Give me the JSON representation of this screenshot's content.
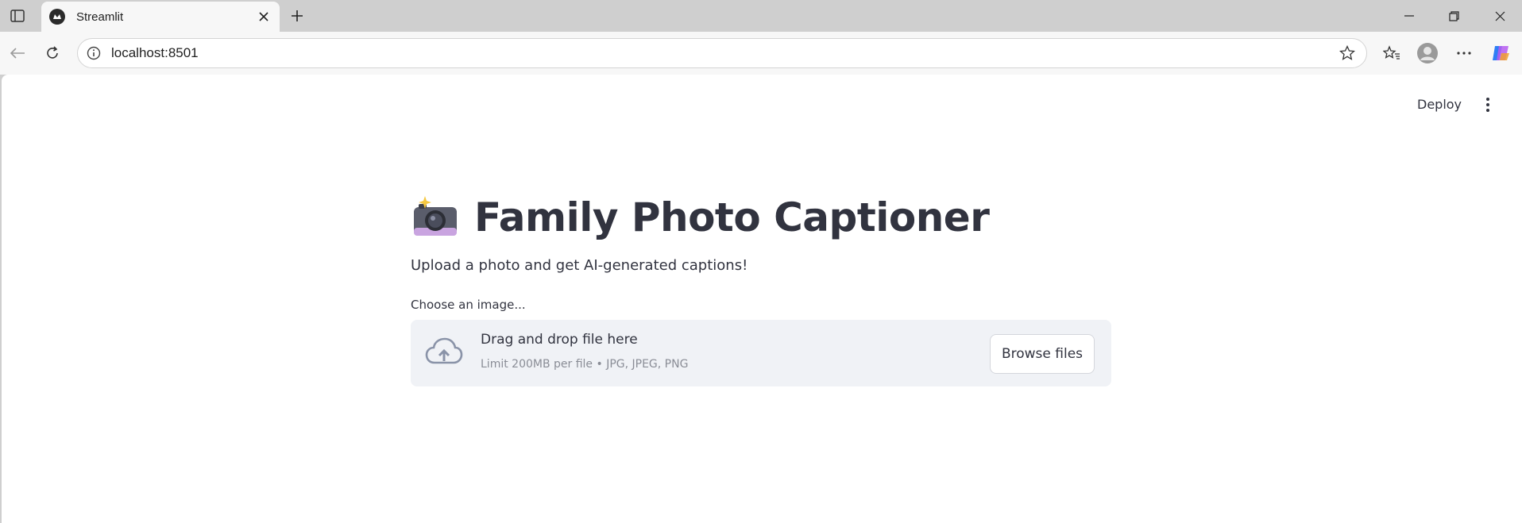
{
  "browser": {
    "tab": {
      "title": "Streamlit",
      "favicon": "streamlit-icon"
    },
    "address": {
      "url": "localhost:8501"
    },
    "icons": {
      "tab_actions": "tab-actions-icon",
      "close_tab": "close-icon",
      "new_tab": "plus-icon",
      "back": "back-arrow-icon",
      "reload": "reload-icon",
      "site_info": "info-icon",
      "favorite": "star-icon",
      "favorites": "favorites-icon",
      "profile": "profile-icon",
      "more": "more-icon",
      "copilot": "copilot-icon"
    }
  },
  "app_header": {
    "deploy_label": "Deploy",
    "menu_icon": "kebab-menu-icon"
  },
  "main": {
    "title_emoji": "camera-flash-emoji",
    "title": "Family Photo Captioner",
    "subtitle": "Upload a photo and get AI-generated captions!",
    "uploader": {
      "label": "Choose an image...",
      "drop_text": "Drag and drop file here",
      "limit_text": "Limit 200MB per file • JPG, JPEG, PNG",
      "browse_label": "Browse files",
      "icon": "cloud-upload-icon"
    }
  },
  "colors": {
    "text": "#31333f",
    "dropzone_bg": "#f0f2f6",
    "muted": "#8a8d96",
    "chrome_bg": "#cfcfcf"
  }
}
